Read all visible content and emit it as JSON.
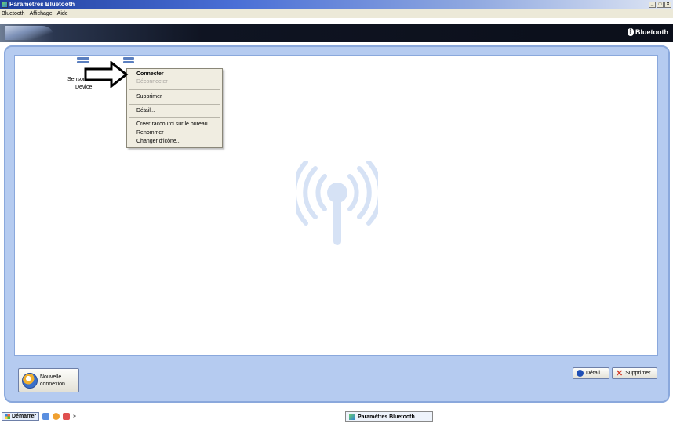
{
  "window": {
    "title": "Paramètres Bluetooth",
    "buttons": [
      "_",
      "□",
      "X"
    ]
  },
  "menu": [
    "Bluetooth",
    "Affichage",
    "Aide"
  ],
  "banner": {
    "logo_text": "Bluetooth"
  },
  "device": {
    "label_line1": "Sensor",
    "label_line2": "Device"
  },
  "context_menu": {
    "connect": "Connecter",
    "disconnect": "Déconnecter",
    "delete": "Supprimer",
    "detail": "Détail...",
    "shortcut": "Créer raccourci sur le bureau",
    "rename": "Renommer",
    "change_icon": "Changer d'icône..."
  },
  "buttons": {
    "new_connection_line1": "Nouvelle",
    "new_connection_line2": "connexion",
    "detail": "Détail...",
    "delete": "Supprimer"
  },
  "taskbar": {
    "start": "Démarrer",
    "more": "»",
    "task_title": "Paramètres Bluetooth"
  },
  "colors": {
    "frame": "#b5cbf0",
    "titlebar": "#1f3f9e",
    "watermark": "#d6e2f5"
  }
}
